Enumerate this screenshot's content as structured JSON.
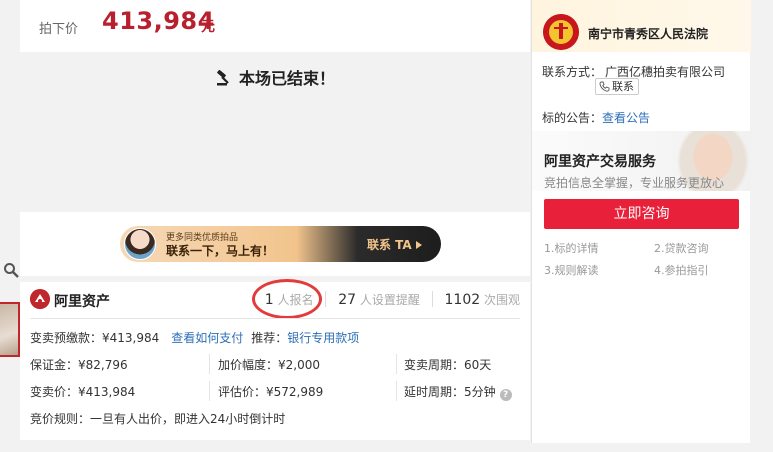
{
  "price": {
    "label": "拍下价",
    "value": "413,984",
    "unit": "元"
  },
  "status": {
    "text": "本场已结束！"
  },
  "ad": {
    "line1": "更多同类优质拍品",
    "line2": "联系一下，马上有！",
    "cta": "联系 TA"
  },
  "brand": {
    "name": "阿里资产"
  },
  "stats": [
    {
      "num": "1",
      "label": "人报名"
    },
    {
      "num": "27",
      "label": "人设置提醒"
    },
    {
      "num": "1102",
      "label": "次围观"
    }
  ],
  "details": {
    "deposit_pay": {
      "label": "变卖预缴款：¥413,984",
      "link": "查看如何支付",
      "recommend_label": "推荐：",
      "recommend_link": "银行专用款项"
    },
    "margin": "保证金：¥82,796",
    "increment": "加价幅度：¥2,000",
    "period": "变卖周期：60天",
    "sale_price": "变卖价：¥413,984",
    "valuation": "评估价：¥572,989",
    "delay": "延时周期：5分钟",
    "rule": "竞价规则：一旦有人出价，即进入24小时倒计时"
  },
  "side": {
    "court_name": "南宁市青秀区人民法院",
    "contact_label": "联系方式：",
    "contact_value": "广西亿穗拍卖有限公司",
    "contact_button": "联系",
    "notice_label": "标的公告：",
    "notice_link": "查看公告",
    "service_title": "阿里资产交易服务",
    "service_subtitle": "竞拍信息全掌握，专业服务更放心",
    "consult_button": "立即咨询",
    "steps": [
      "1.标的详情",
      "2.贷款咨询",
      "3.规则解读",
      "4.参拍指引"
    ]
  },
  "colors": {
    "price_red": "#b8202e",
    "consult_red": "#e8203a",
    "link_blue": "#2d6fb7",
    "highlight_circle": "#e23b3b"
  }
}
